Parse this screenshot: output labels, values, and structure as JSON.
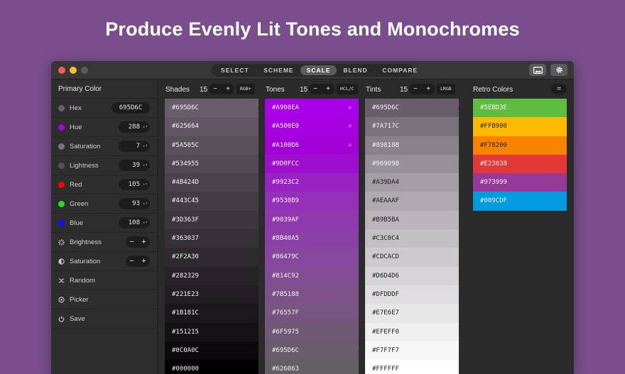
{
  "headline": "Produce Evenly Lit Tones and Monochromes",
  "toolbar": {
    "tabs": [
      {
        "label": "SELECT"
      },
      {
        "label": "SCHEME"
      },
      {
        "label": "SCALE",
        "active": true
      },
      {
        "label": "BLEND"
      },
      {
        "label": "COMPARE"
      }
    ],
    "image_button_icon": "image-icon",
    "settings_button_icon": "gear-icon"
  },
  "sidebar": {
    "title": "Primary Color",
    "hex": {
      "label": "Hex",
      "value": "695D6C",
      "dot": "#695D6C"
    },
    "hue": {
      "label": "Hue",
      "value": "288",
      "dot": "#A900EA"
    },
    "saturation": {
      "label": "Saturation",
      "value": "7",
      "dot": "#7A717C"
    },
    "lightness": {
      "label": "Lightness",
      "value": "39",
      "dot": "#5A505C"
    },
    "red": {
      "label": "Red",
      "value": "105",
      "dot": "#FF0000"
    },
    "green": {
      "label": "Green",
      "value": "93",
      "dot": "#22E022"
    },
    "blue": {
      "label": "Blue",
      "value": "108",
      "dot": "#1010FF"
    },
    "brightness": {
      "label": "Brightness",
      "minus": "−",
      "plus": "+"
    },
    "saturation_adj": {
      "label": "Saturation",
      "minus": "−",
      "plus": "+"
    },
    "random": {
      "label": "Random"
    },
    "picker": {
      "label": "Picker"
    },
    "save": {
      "label": "Save"
    }
  },
  "shades": {
    "title": "Shades",
    "count": "15",
    "minus": "−",
    "plus": "+",
    "space": "RGB+",
    "colors": [
      "#695D6C",
      "#625664",
      "#5A505C",
      "#534955",
      "#4B424D",
      "#443C45",
      "#3D363F",
      "#363037",
      "#2F2A30",
      "#282329",
      "#221E23",
      "#1B181C",
      "#151215",
      "#0C0A0C",
      "#000000"
    ]
  },
  "tones": {
    "title": "Tones",
    "count": "15",
    "minus": "−",
    "plus": "+",
    "space": "HCL/C",
    "colors": [
      "#A900EA",
      "#A500E0",
      "#A100D6",
      "#9D0FCC",
      "#9923C2",
      "#9530B9",
      "#9039AF",
      "#8B40A5",
      "#86479C",
      "#814C92",
      "#7B5188",
      "#76557F",
      "#6F5975",
      "#695D6C",
      "#626063"
    ]
  },
  "tints": {
    "title": "Tints",
    "count": "15",
    "minus": "−",
    "plus": "+",
    "space": "LRGB",
    "colors": [
      "#695D6C",
      "#7A717C",
      "#89818B",
      "#969098",
      "#A39DA4",
      "#AEAAAF",
      "#B9B5BA",
      "#C3C0C4",
      "#CDCACD",
      "#D6D4D6",
      "#DFDDDF",
      "#E7E6E7",
      "#EFEFF0",
      "#F7F7F7",
      "#FFFFFF"
    ]
  },
  "retro": {
    "title": "Retro Colors",
    "menu": "=",
    "colors": [
      "#5EBD3E",
      "#FFB900",
      "#F78200",
      "#E23838",
      "#973999",
      "#009CDF"
    ]
  }
}
